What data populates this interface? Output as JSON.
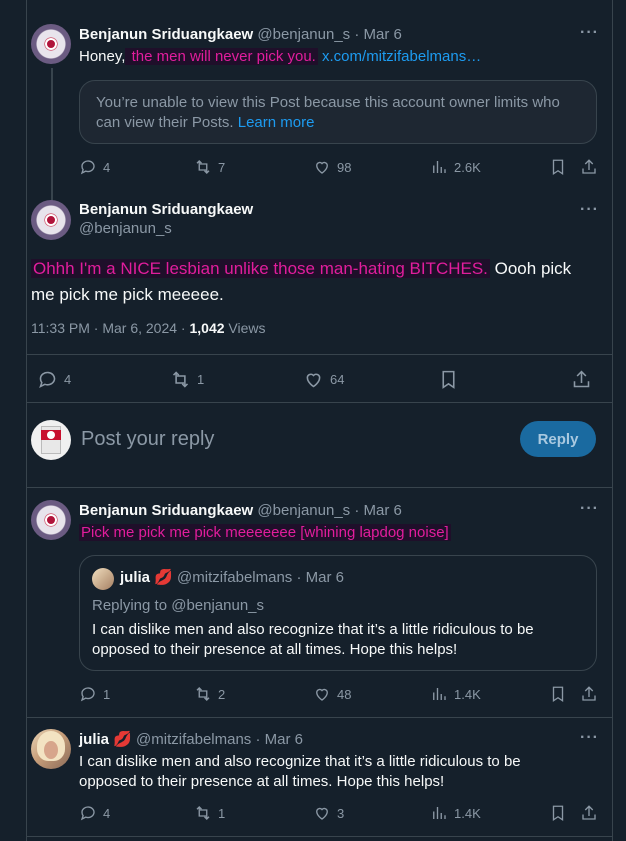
{
  "colors": {
    "background": "#15202b",
    "text": "#f7f9f9",
    "muted": "#8b98a5",
    "link": "#1d9bf0",
    "highlight": "#e11d9c",
    "reply_button": "#1a6aa0"
  },
  "thread": [
    {
      "author": "Benjanun Sriduangkaew",
      "handle": "@benjanun_s",
      "date": "· Mar 6",
      "text_prefix": "Honey,",
      "text_highlight": " the men will never pick you.",
      "link": "x.com/mitzifabelmans…",
      "notice": "You’re unable to view this Post because this account owner limits who can view their Posts.",
      "notice_link": "Learn more",
      "stats": {
        "replies": "4",
        "reposts": "7",
        "likes": "98",
        "views": "2.6K"
      }
    }
  ],
  "main_post": {
    "author": "Benjanun Sriduangkaew",
    "handle": "@benjanun_s",
    "text_highlight": "Ohhh I'm a NICE lesbian unlike those man-hating BITCHES.",
    "text_rest": " Oooh pick me pick me pick meeeee.",
    "time": "11:33 PM · Mar 6, 2024 ·",
    "views_count": "1,042",
    "views_label": "Views",
    "stats": {
      "replies": "4",
      "reposts": "1",
      "likes": "64"
    }
  },
  "composer": {
    "placeholder": "Post your reply",
    "button": "Reply"
  },
  "replies": [
    {
      "author": "Benjanun Sriduangkaew",
      "handle": "@benjanun_s",
      "date": "· Mar 6",
      "text_highlight": "Pick me pick me pick meeeeeee [whining lapdog noise]",
      "quote": {
        "author": "julia",
        "emoji": "💋",
        "handle": "@mitzifabelmans",
        "date": "· Mar 6",
        "replying": "Replying to @benjanun_s",
        "text": "I can dislike men and also recognize that it’s a little ridiculous to be opposed to their presence at all times. Hope this helps!"
      },
      "stats": {
        "replies": "1",
        "reposts": "2",
        "likes": "48",
        "views": "1.4K"
      }
    },
    {
      "author": "julia",
      "emoji": "💋",
      "handle": "@mitzifabelmans",
      "date": "· Mar 6",
      "text": "I can dislike men and also recognize that it’s a little ridiculous to be opposed to their presence at all times. Hope this helps!",
      "stats": {
        "replies": "4",
        "reposts": "1",
        "likes": "3",
        "views": "1.4K"
      }
    }
  ],
  "icons": [
    "reply-icon",
    "repost-icon",
    "like-icon",
    "views-icon",
    "bookmark-icon",
    "share-icon",
    "more-icon"
  ]
}
